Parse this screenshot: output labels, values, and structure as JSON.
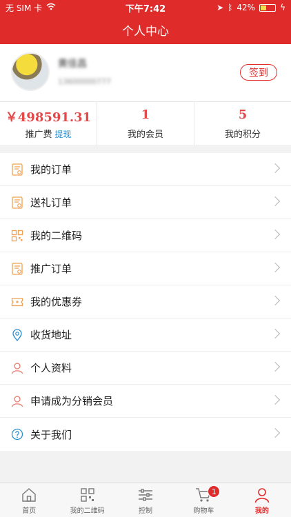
{
  "status_bar": {
    "carrier": "无 SIM 卡",
    "time": "下午7:42",
    "battery": "42%",
    "battery_level": 0.42
  },
  "header": {
    "title": "个人中心"
  },
  "profile": {
    "name": "黄佳昌",
    "phone": "13600000777",
    "signin_label": "签到"
  },
  "stats": [
    {
      "value": "￥498591.31",
      "label": "推广费",
      "link": "提现"
    },
    {
      "value": "1",
      "label": "我的会员"
    },
    {
      "value": "5",
      "label": "我的积分"
    }
  ],
  "menu": [
    {
      "label": "我的订单",
      "icon": "order-icon"
    },
    {
      "label": "送礼订单",
      "icon": "gift-order-icon"
    },
    {
      "label": "我的二维码",
      "icon": "qrcode-icon"
    },
    {
      "label": "推广订单",
      "icon": "promo-order-icon"
    },
    {
      "label": "我的优惠券",
      "icon": "coupon-icon"
    },
    {
      "label": "收货地址",
      "icon": "location-icon"
    },
    {
      "label": "个人资料",
      "icon": "user-icon"
    },
    {
      "label": "申请成为分销会员",
      "icon": "user-apply-icon"
    },
    {
      "label": "关于我们",
      "icon": "help-icon"
    }
  ],
  "tabbar": [
    {
      "label": "首页",
      "icon": "home-icon"
    },
    {
      "label": "我的二维码",
      "icon": "qrcode-icon"
    },
    {
      "label": "控制",
      "icon": "sliders-icon"
    },
    {
      "label": "购物车",
      "icon": "cart-icon",
      "badge": "1"
    },
    {
      "label": "我的",
      "icon": "user-icon",
      "active": true
    }
  ],
  "colors": {
    "brand": "#e02b2b",
    "price": "#e34949",
    "link": "#1a8fd8",
    "icon_orange": "#f0a050",
    "icon_blue": "#2a8fd0"
  }
}
